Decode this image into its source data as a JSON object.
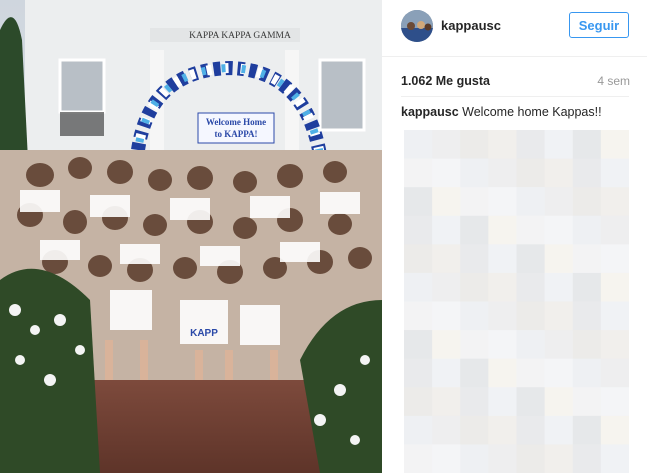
{
  "post": {
    "username": "kappausc",
    "follow_label": "Seguir",
    "likes": "1.062 Me gusta",
    "time_ago": "4 sem",
    "caption": {
      "username": "kappausc",
      "text": "Welcome home Kappas!!"
    }
  },
  "photo": {
    "house_sign": "KAPPA KAPPA GAMMA",
    "banner_line1": "Welcome Home",
    "banner_line2": "to KAPPA!",
    "shirt_text": "KAPP"
  },
  "colors": {
    "accent": "#3897f0",
    "text": "#262626",
    "muted": "#999999"
  },
  "icons": {
    "avatar": "profile-photo"
  }
}
